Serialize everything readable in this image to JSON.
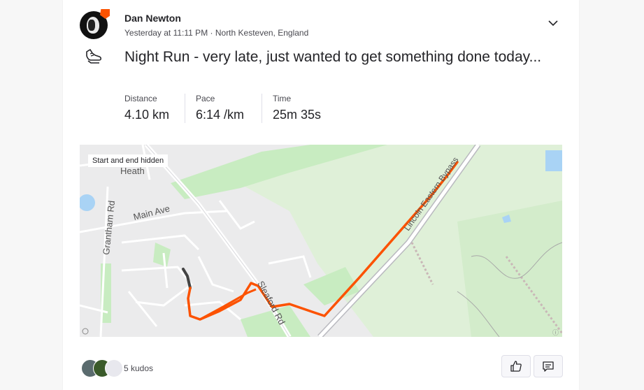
{
  "athlete": {
    "name": "Dan Newton",
    "meta": "Yesterday at 11:11 PM · North Kesteven, England"
  },
  "activity": {
    "type_icon": "shoe-icon",
    "title": "Night Run - very late, just wanted to get something done today...",
    "stats": [
      {
        "label": "Distance",
        "value": "4.10 km"
      },
      {
        "label": "Pace",
        "value": "6:14 /km"
      },
      {
        "label": "Time",
        "value": "25m 35s"
      }
    ]
  },
  "map": {
    "chip": "Start and end hidden",
    "labels": {
      "heath": "Heath",
      "main_ave": "Main Ave",
      "grantham_rd": "Grantham Rd",
      "sleaford_rd": "Sleaford Rd",
      "bypass": "Lincoln Eastern Bypass"
    },
    "route_color": "#fc5200"
  },
  "kudos": {
    "count_label": "5 kudos"
  },
  "actions": {
    "kudos_icon": "thumbs-up-icon",
    "comment_icon": "comment-icon"
  },
  "colors": {
    "accent": "#fc5200",
    "park": "#c8ecc1",
    "field": "#dff0d8"
  }
}
